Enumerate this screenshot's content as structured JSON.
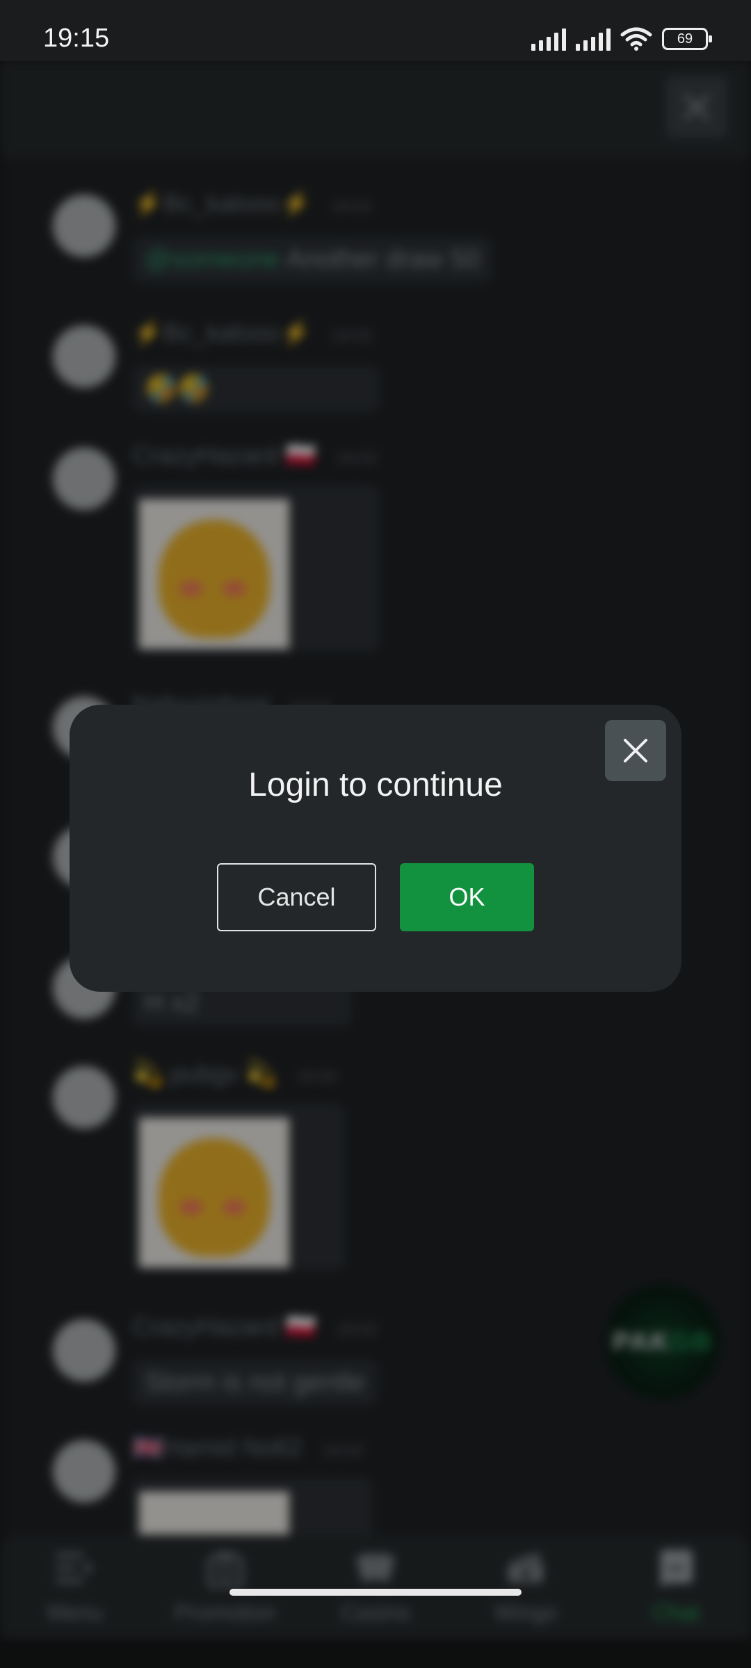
{
  "status_bar": {
    "time": "19:15",
    "battery": "69"
  },
  "chat": {
    "messages": [
      {
        "user": "⚡Bc_kalooo⚡",
        "time": "19:02",
        "mention": "@someone",
        "text": "Another draw 50"
      },
      {
        "user": "⚡Bc_kalooo⚡",
        "time": "19:02",
        "text": "🤣🤣"
      },
      {
        "user": "CrazyHazard 🇵🇱",
        "time": "19:02",
        "sticker": "bear-sticker"
      },
      {
        "user": "Nabxxinhgai",
        "time": "19:02"
      },
      {
        "text": "H x2"
      },
      {
        "user": "💫 pubgv 💫",
        "time": "19:02",
        "sticker": "bear-thermometer-sticker"
      },
      {
        "user": "CrazyHazard 🇵🇱",
        "time": "19:02",
        "text": "Storm is not gentle"
      },
      {
        "user": "🇬🇧Hamid No62",
        "time": "19:02",
        "sticker": "text-sticker"
      }
    ]
  },
  "floating_logo": {
    "part1": "PAK",
    "part2": "GB"
  },
  "bottom_nav": {
    "items": [
      {
        "label": "Menu",
        "icon": "menu-icon"
      },
      {
        "label": "Promotion",
        "icon": "gift-icon"
      },
      {
        "label": "Casino",
        "icon": "cards-icon"
      },
      {
        "label": "Wingo",
        "icon": "ticket-icon"
      },
      {
        "label": "Chat",
        "icon": "chat-icon",
        "active": true
      }
    ]
  },
  "dialog": {
    "title": "Login to continue",
    "cancel_label": "Cancel",
    "ok_label": "OK"
  },
  "colors": {
    "accent": "#12923f",
    "active_nav": "#1fa856",
    "dialog_bg": "#23272a"
  }
}
